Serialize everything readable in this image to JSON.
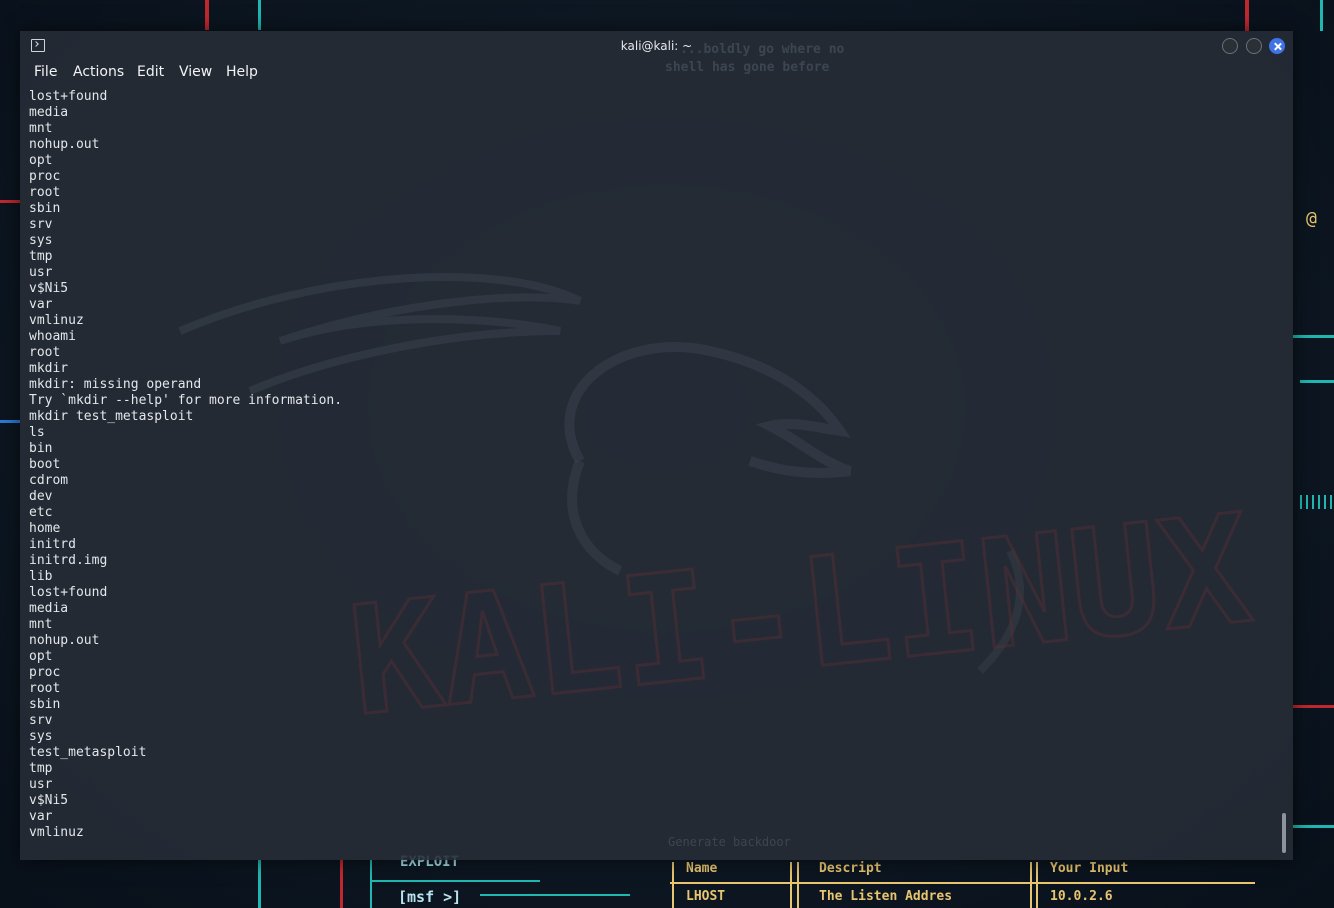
{
  "window": {
    "title": "kali@kali: ~"
  },
  "menu": {
    "items": [
      "File",
      "Actions",
      "Edit",
      "View",
      "Help"
    ]
  },
  "terminal": {
    "lines": [
      "lost+found",
      "media",
      "mnt",
      "nohup.out",
      "opt",
      "proc",
      "root",
      "sbin",
      "srv",
      "sys",
      "tmp",
      "usr",
      "v$Ni5",
      "var",
      "vmlinuz",
      "whoami",
      "root",
      "mkdir",
      "mkdir: missing operand",
      "Try `mkdir --help' for more information.",
      "mkdir test_metasploit",
      "ls",
      "bin",
      "boot",
      "cdrom",
      "dev",
      "etc",
      "home",
      "initrd",
      "initrd.img",
      "lib",
      "lost+found",
      "media",
      "mnt",
      "nohup.out",
      "opt",
      "proc",
      "root",
      "sbin",
      "srv",
      "sys",
      "test_metasploit",
      "tmp",
      "usr",
      "v$Ni5",
      "var",
      "vmlinuz"
    ]
  },
  "wallpaper": {
    "motto_line1": "...boldly go where no",
    "motto_line2": "shell has gone before",
    "generate_label": "Generate backdoor",
    "exploit_label": "EXPLOIT",
    "msf_prompt": "[msf >]",
    "table_headers": [
      "Name",
      "Descript",
      "Your Input"
    ],
    "table_row": [
      "LHOST",
      "The Listen Addres",
      "10.0.2.6"
    ],
    "logo_text": "KALI-LINUX",
    "colors": {
      "cyan": "#1fb7b0",
      "red": "#c0282f",
      "gold": "#e8c56e",
      "blue": "#2a7bd6"
    }
  }
}
